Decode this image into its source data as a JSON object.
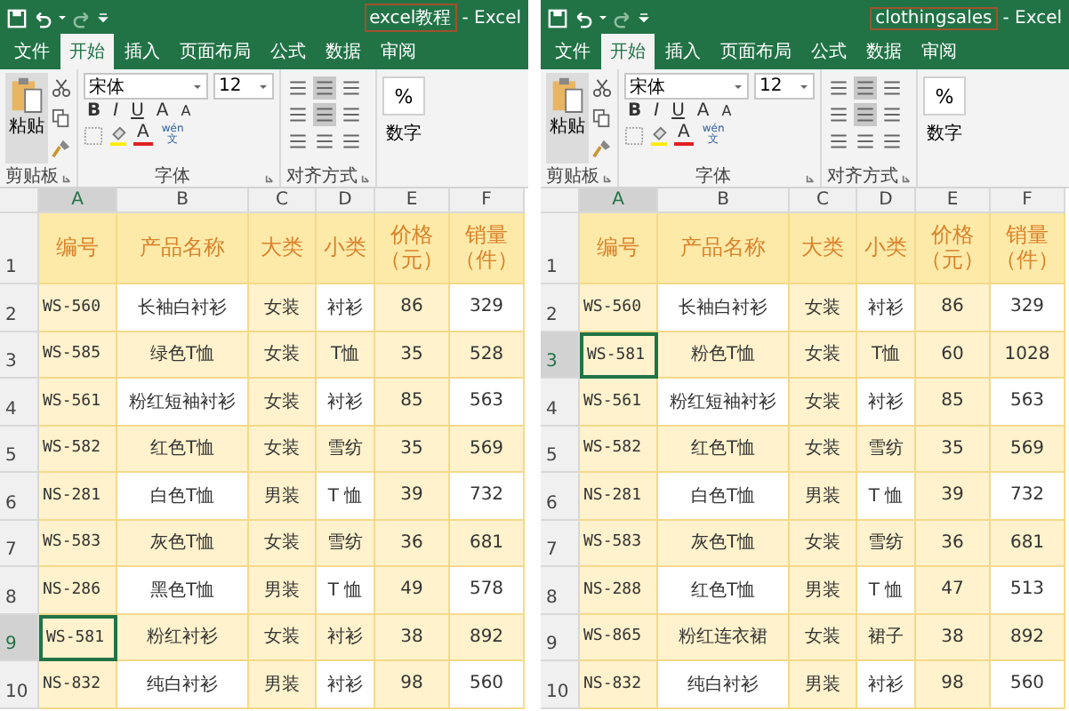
{
  "windows": [
    {
      "title": {
        "file": "excel教程",
        "app": "- Excel"
      },
      "tabs": [
        {
          "label": "文件",
          "selected": false
        },
        {
          "label": "开始",
          "selected": true
        },
        {
          "label": "插入",
          "selected": false
        },
        {
          "label": "页面布局",
          "selected": false
        },
        {
          "label": "公式",
          "selected": false
        },
        {
          "label": "数据",
          "selected": false
        },
        {
          "label": "审阅",
          "selected": false
        }
      ],
      "ribbon": {
        "paste": "粘贴",
        "font": "宋体",
        "size": "12",
        "bold": "B",
        "italic": "I",
        "underline": "U",
        "grow": "A",
        "shrink": "A",
        "font_color": "A",
        "phonetic": "wén\n文",
        "percent": "%",
        "number": "数字",
        "groups": [
          "剪贴板",
          "字体",
          "对齐方式"
        ]
      },
      "sheet": {
        "columns": [
          "A",
          "B",
          "C",
          "D",
          "E",
          "F"
        ],
        "header_row": "1",
        "header": [
          "编号",
          "产品名称",
          "大类",
          "小类",
          "价格（元）",
          "销量（件）"
        ],
        "rows": [
          {
            "row": "2",
            "selected": false,
            "cells": [
              "WS-560",
              "长袖白衬衫",
              "女装",
              "衬衫",
              "86",
              "329"
            ]
          },
          {
            "row": "3",
            "selected": false,
            "cells": [
              "WS-585",
              "绿色T恤",
              "女装",
              "T恤",
              "35",
              "528"
            ]
          },
          {
            "row": "4",
            "selected": false,
            "cells": [
              "WS-561",
              "粉红短袖衬衫",
              "女装",
              "衬衫",
              "85",
              "563"
            ]
          },
          {
            "row": "5",
            "selected": false,
            "cells": [
              "WS-582",
              "红色T恤",
              "女装",
              "雪纺",
              "35",
              "569"
            ]
          },
          {
            "row": "6",
            "selected": false,
            "cells": [
              "NS-281",
              "白色T恤",
              "男装",
              "T 恤",
              "39",
              "732"
            ]
          },
          {
            "row": "7",
            "selected": false,
            "cells": [
              "WS-583",
              "灰色T恤",
              "女装",
              "雪纺",
              "36",
              "681"
            ]
          },
          {
            "row": "8",
            "selected": false,
            "cells": [
              "NS-286",
              "黑色T恤",
              "男装",
              "T 恤",
              "49",
              "578"
            ]
          },
          {
            "row": "9",
            "selected": true,
            "cells": [
              "WS-581",
              "粉红衬衫",
              "女装",
              "衬衫",
              "38",
              "892"
            ]
          },
          {
            "row": "10",
            "selected": false,
            "cells": [
              "NS-832",
              "纯白衬衫",
              "男装",
              "衬衫",
              "98",
              "560"
            ]
          }
        ]
      }
    },
    {
      "title": {
        "file": "clothingsales",
        "app": "- Excel"
      },
      "tabs": [
        {
          "label": "文件",
          "selected": false
        },
        {
          "label": "开始",
          "selected": true
        },
        {
          "label": "插入",
          "selected": false
        },
        {
          "label": "页面布局",
          "selected": false
        },
        {
          "label": "公式",
          "selected": false
        },
        {
          "label": "数据",
          "selected": false
        },
        {
          "label": "审阅",
          "selected": false
        }
      ],
      "ribbon": {
        "paste": "粘贴",
        "font": "宋体",
        "size": "12",
        "bold": "B",
        "italic": "I",
        "underline": "U",
        "grow": "A",
        "shrink": "A",
        "font_color": "A",
        "phonetic": "wén\n文",
        "percent": "%",
        "number": "数字",
        "groups": [
          "剪贴板",
          "字体",
          "对齐方式"
        ]
      },
      "sheet": {
        "columns": [
          "A",
          "B",
          "C",
          "D",
          "E",
          "F"
        ],
        "header_row": "1",
        "header": [
          "编号",
          "产品名称",
          "大类",
          "小类",
          "价格（元）",
          "销量（件）"
        ],
        "rows": [
          {
            "row": "2",
            "selected": false,
            "cells": [
              "WS-560",
              "长袖白衬衫",
              "女装",
              "衬衫",
              "86",
              "329"
            ]
          },
          {
            "row": "3",
            "selected": true,
            "cells": [
              "WS-581",
              "粉色T恤",
              "女装",
              "T恤",
              "60",
              "1028"
            ]
          },
          {
            "row": "4",
            "selected": false,
            "cells": [
              "WS-561",
              "粉红短袖衬衫",
              "女装",
              "衬衫",
              "85",
              "563"
            ]
          },
          {
            "row": "5",
            "selected": false,
            "cells": [
              "WS-582",
              "红色T恤",
              "女装",
              "雪纺",
              "35",
              "569"
            ]
          },
          {
            "row": "6",
            "selected": false,
            "cells": [
              "NS-281",
              "白色T恤",
              "男装",
              "T 恤",
              "39",
              "732"
            ]
          },
          {
            "row": "7",
            "selected": false,
            "cells": [
              "WS-583",
              "灰色T恤",
              "女装",
              "雪纺",
              "36",
              "681"
            ]
          },
          {
            "row": "8",
            "selected": false,
            "cells": [
              "NS-288",
              "红色T恤",
              "男装",
              "T 恤",
              "47",
              "513"
            ]
          },
          {
            "row": "9",
            "selected": false,
            "cells": [
              "WS-865",
              "粉红连衣裙",
              "女装",
              "裙子",
              "38",
              "892"
            ]
          },
          {
            "row": "10",
            "selected": false,
            "cells": [
              "NS-832",
              "纯白衬衫",
              "男装",
              "衬衫",
              "98",
              "560"
            ]
          }
        ]
      }
    }
  ]
}
